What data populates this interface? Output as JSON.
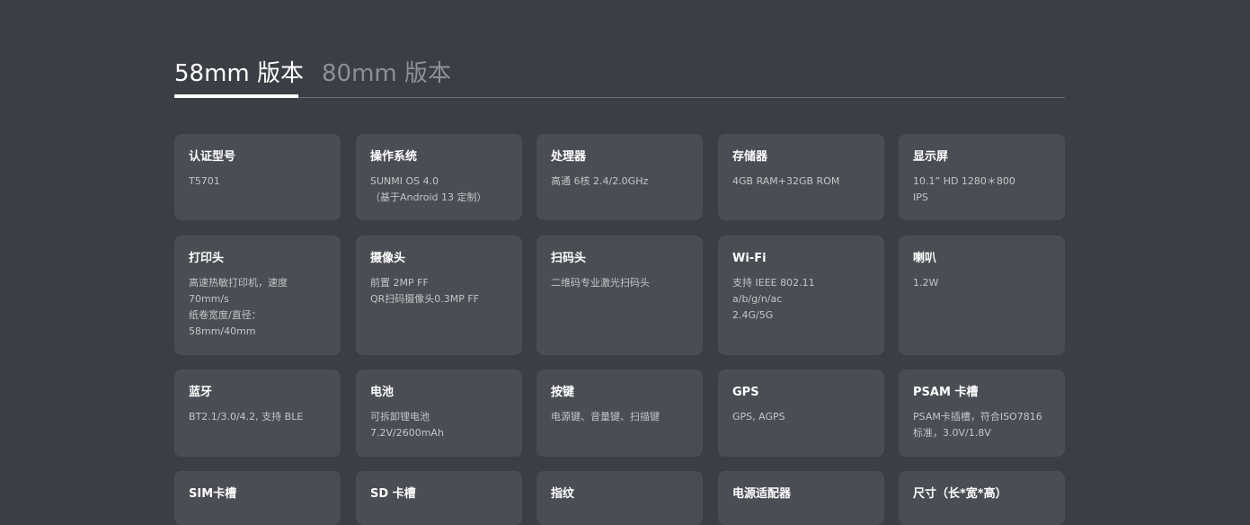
{
  "tabs": [
    {
      "label": "58mm 版本",
      "active": true
    },
    {
      "label": "80mm 版本",
      "active": false
    }
  ],
  "specs": [
    {
      "title": "认证型号",
      "lines": [
        "T5701"
      ]
    },
    {
      "title": "操作系统",
      "lines": [
        "SUNMI OS 4.0",
        "（基于Android 13 定制）"
      ]
    },
    {
      "title": "处理器",
      "lines": [
        "高通 6核 2.4/2.0GHz"
      ]
    },
    {
      "title": "存储器",
      "lines": [
        "4GB RAM+32GB ROM"
      ]
    },
    {
      "title": "显示屏",
      "lines": [
        "10.1”  HD 1280＊800",
        "IPS"
      ]
    },
    {
      "title": "打印头",
      "lines": [
        "高速热敏打印机，速度",
        "70mm/s",
        "纸卷宽度/直径：",
        "58mm/40mm"
      ]
    },
    {
      "title": "摄像头",
      "lines": [
        "前置 2MP FF",
        "QR扫码摄像头0.3MP FF"
      ]
    },
    {
      "title": "扫码头",
      "lines": [
        "二维码专业激光扫码头"
      ]
    },
    {
      "title": "Wi-Fi",
      "lines": [
        "支持 IEEE 802.11",
        "a/b/g/n/ac",
        "2.4G/5G"
      ]
    },
    {
      "title": "喇叭",
      "lines": [
        "1.2W"
      ]
    },
    {
      "title": "蓝牙",
      "lines": [
        "BT2.1/3.0/4.2, 支持 BLE"
      ]
    },
    {
      "title": "电池",
      "lines": [
        "可拆卸锂电池",
        "7.2V/2600mAh"
      ]
    },
    {
      "title": "按键",
      "lines": [
        "电源键、音量键、扫描键"
      ]
    },
    {
      "title": "GPS",
      "lines": [
        "GPS, AGPS"
      ]
    },
    {
      "title": "PSAM 卡槽",
      "lines": [
        "PSAM卡插槽，符合ISO7816",
        "标准，3.0V/1.8V"
      ]
    },
    {
      "title": "SIM卡槽",
      "lines": []
    },
    {
      "title": "SD 卡槽",
      "lines": []
    },
    {
      "title": "指纹",
      "lines": []
    },
    {
      "title": "电源适配器",
      "lines": []
    },
    {
      "title": "尺寸（长*宽*高）",
      "lines": []
    }
  ]
}
